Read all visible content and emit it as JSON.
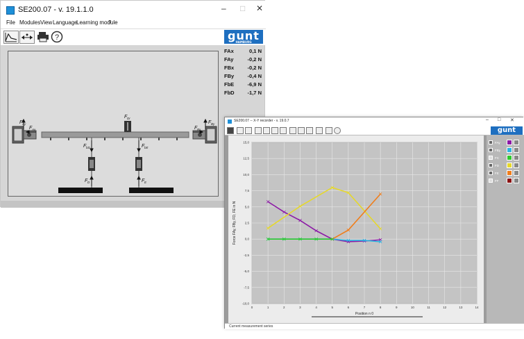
{
  "main_window": {
    "title": "SE200.07 - v. 19.1.1.0",
    "menu": [
      "File",
      "Modules",
      "View",
      "Language",
      "Learning module",
      "?"
    ],
    "logo_text": "gunt",
    "logo_sub": "HAMBURG",
    "forces": [
      {
        "label": "FAx",
        "value": "0,1",
        "unit": "N"
      },
      {
        "label": "FAy",
        "value": "-0,2",
        "unit": "N"
      },
      {
        "label": "FBx",
        "value": "-0,2",
        "unit": "N"
      },
      {
        "label": "FBy",
        "value": "-0,4",
        "unit": "N"
      },
      {
        "label": "FbE",
        "value": "-6,9",
        "unit": "N"
      },
      {
        "label": "FbD",
        "value": "-1,7",
        "unit": "N"
      }
    ],
    "diagram_labels": {
      "fax": "F",
      "fax_sub": "Ax",
      "fay": "F",
      "fay_sub": "Ay",
      "fbx": "F",
      "fbx_sub": "Bx",
      "fby": "F",
      "fby_sub": "By",
      "fdr": "F",
      "fdr_sub": "Dr",
      "fbd": "F",
      "fbd_sub": "bD",
      "fbe": "F",
      "fbe_sub": "bE",
      "fd": "F",
      "fd_sub": "D",
      "fe": "F",
      "fe_sub": "E"
    },
    "colors": {
      "logo": "#1e6fc0",
      "canvas": "#dcdcdc",
      "beam": "#9a9a9a",
      "foundation": "#111111"
    }
  },
  "recorder_window": {
    "title": "SE200.07 -- X-Y recorder - v. 19.0.7",
    "logo_text": "gunt",
    "status": "Current measurement series",
    "legend": [
      {
        "label": "FAy",
        "checked": true,
        "color": "#8c1aa6"
      },
      {
        "label": "FBy",
        "checked": true,
        "color": "#2bb3e0"
      },
      {
        "label": "FC",
        "checked": false,
        "color": "#2ec82e"
      },
      {
        "label": "FD",
        "checked": true,
        "color": "#e6d82a"
      },
      {
        "label": "FE",
        "checked": true,
        "color": "#f07d1a"
      },
      {
        "label": "FF",
        "checked": false,
        "color": "#8a1010"
      }
    ]
  },
  "chart_data": {
    "type": "line",
    "xlabel": "Position n 0",
    "ylabel": "Force FAy, FBy, FD, FE in N",
    "xlim": [
      0,
      14
    ],
    "ylim": [
      -10,
      10
    ],
    "xticks": [
      "0",
      "1",
      "2",
      "3",
      "4",
      "5",
      "6",
      "7",
      "8",
      "9",
      "10",
      "11",
      "12",
      "13",
      "14"
    ],
    "yticks": [
      "-10,0",
      "-7,5",
      "-5,0",
      "-2,5",
      "0,0",
      "2,5",
      "5,0",
      "7,5",
      "10,0",
      "12,5",
      "15,0"
    ],
    "y_axis_max": 15,
    "grid": true,
    "series": [
      {
        "name": "FAy",
        "color": "#8c1aa6",
        "x": [
          1,
          2,
          3,
          4,
          5,
          6,
          7,
          8
        ],
        "values": [
          5.8,
          4.2,
          2.9,
          1.3,
          0.0,
          -0.4,
          -0.3,
          -0.1
        ]
      },
      {
        "name": "FBy",
        "color": "#2bb3e0",
        "x": [
          1,
          2,
          3,
          4,
          5,
          6,
          7,
          8
        ],
        "values": [
          0.0,
          0.0,
          0.0,
          0.0,
          0.0,
          -0.2,
          -0.2,
          -0.4
        ]
      },
      {
        "name": "FD",
        "color": "#e6d82a",
        "x": [
          1,
          3,
          5,
          6,
          8
        ],
        "values": [
          1.7,
          5.1,
          8.0,
          7.2,
          1.6
        ]
      },
      {
        "name": "FE",
        "color": "#f07d1a",
        "x": [
          5,
          6,
          8
        ],
        "values": [
          0.0,
          1.4,
          7.0
        ]
      },
      {
        "name": "FC",
        "color": "#2ec82e",
        "x": [
          1,
          2,
          3,
          4,
          5
        ],
        "values": [
          0.0,
          0.0,
          0.0,
          0.0,
          0.0
        ]
      }
    ]
  }
}
